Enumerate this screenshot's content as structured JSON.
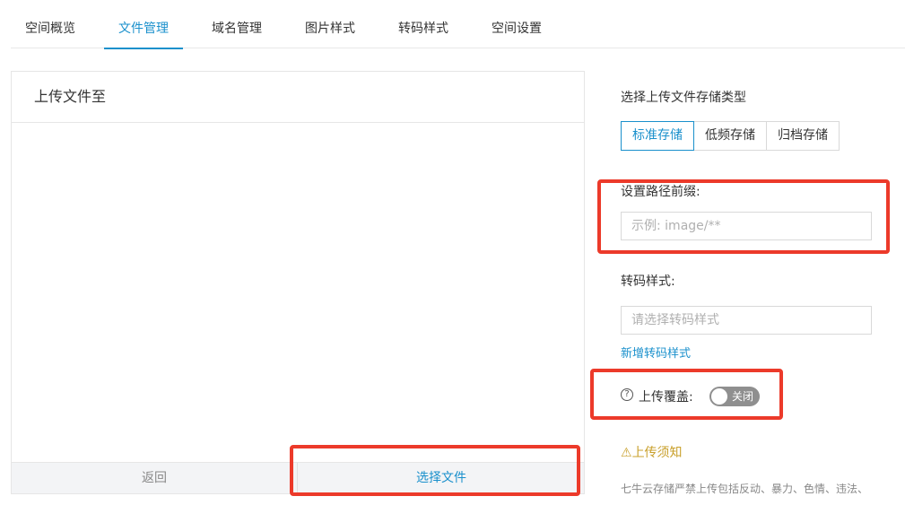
{
  "tabs": [
    {
      "label": "空间概览"
    },
    {
      "label": "文件管理"
    },
    {
      "label": "域名管理"
    },
    {
      "label": "图片样式"
    },
    {
      "label": "转码样式"
    },
    {
      "label": "空间设置"
    }
  ],
  "upload_panel": {
    "title": "上传文件至",
    "back_label": "返回",
    "choose_label": "选择文件"
  },
  "settings": {
    "storage_type_label": "选择上传文件存储类型",
    "storage_options": [
      "标准存储",
      "低频存储",
      "归档存储"
    ],
    "storage_selected": "标准存储",
    "prefix_label": "设置路径前缀:",
    "prefix_placeholder": "示例: image/**",
    "prefix_value": "",
    "transcode_label": "转码样式:",
    "transcode_placeholder": "请选择转码样式",
    "add_transcode_link": "新增转码样式",
    "overwrite_label": "上传覆盖:",
    "overwrite_switch_text": "关闭",
    "overwrite_enabled": false
  },
  "notice": {
    "title": "上传须知",
    "text": "七牛云存储严禁上传包括反动、暴力、色情、违法、"
  },
  "colors": {
    "accent": "#1a90cc",
    "highlight": "#ec3a2a",
    "notice": "#c9a02c"
  }
}
